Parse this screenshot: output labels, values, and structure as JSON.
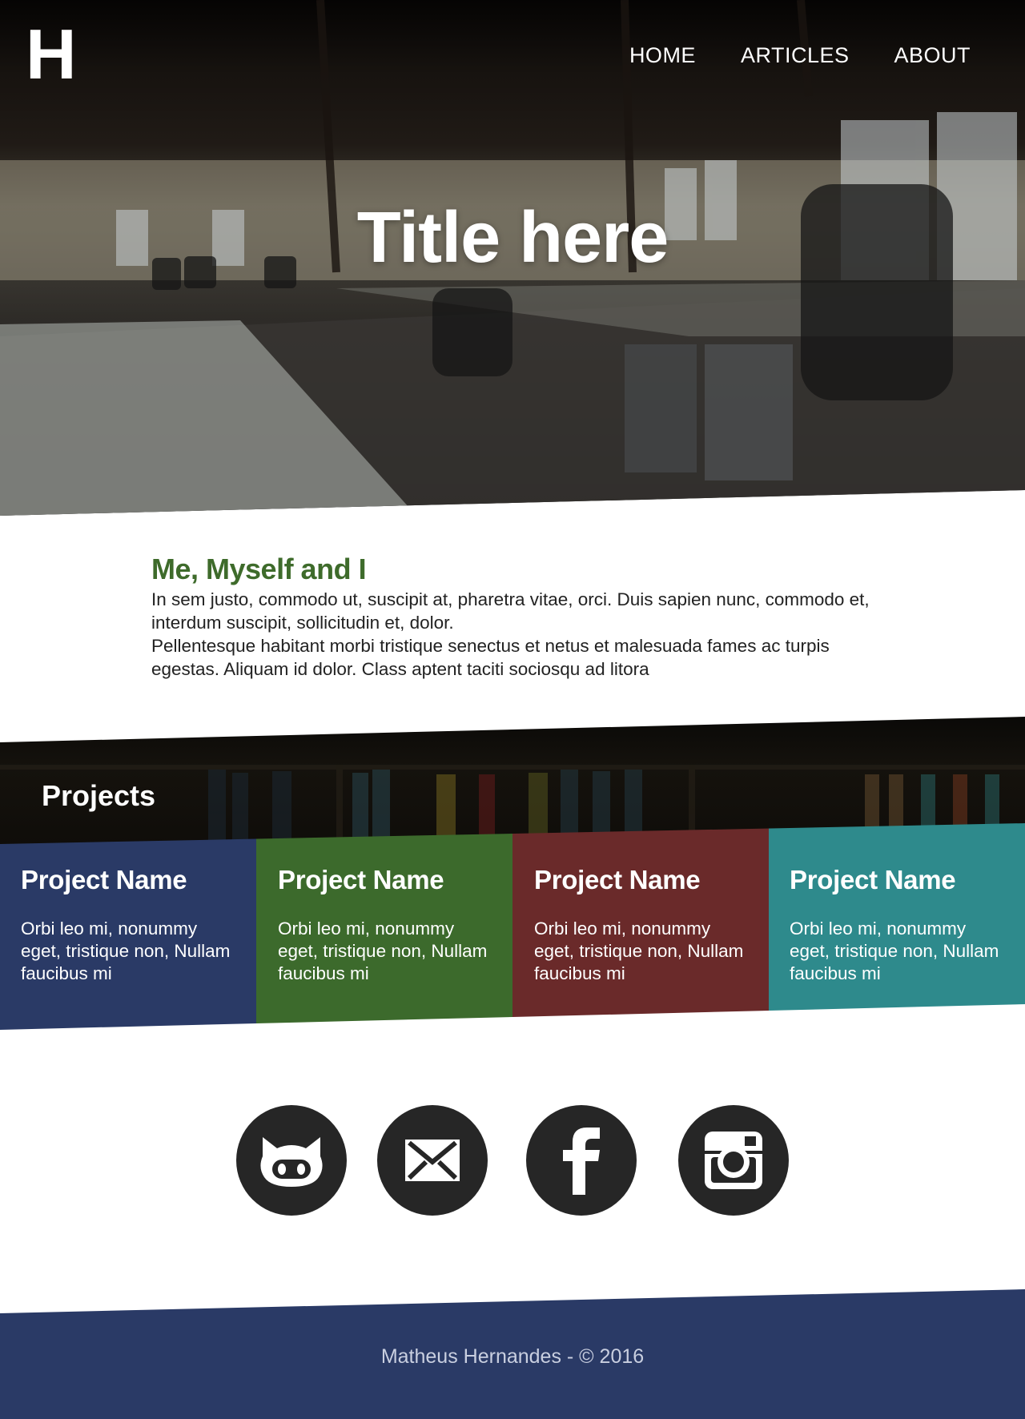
{
  "header": {
    "logo": "H",
    "nav": [
      "HOME",
      "ARTICLES",
      "ABOUT"
    ],
    "title": "Title here"
  },
  "about": {
    "heading": "Me, Myself and I",
    "paragraph1": "In sem justo, commodo ut, suscipit at, pharetra vitae, orci. Duis sapien nunc, commodo et, interdum suscipit, sollicitudin et, dolor.",
    "paragraph2": "Pellentesque habitant morbi tristique senectus et netus et malesuada fames ac turpis egestas. Aliquam id dolor. Class aptent taciti sociosqu ad litora"
  },
  "projects": {
    "title": "Projects",
    "items": [
      {
        "name": "Project Name",
        "description": "Orbi leo mi, nonummy eget, tristique non, Nullam faucibus mi",
        "color": "#2a3a66"
      },
      {
        "name": "Project Name",
        "description": "Orbi leo mi, nonummy eget, tristique non, Nullam faucibus mi",
        "color": "#3c6a2c"
      },
      {
        "name": "Project Name",
        "description": "Orbi leo mi, nonummy eget, tristique non, Nullam faucibus mi",
        "color": "#6a2a2a"
      },
      {
        "name": "Project Name",
        "description": "Orbi leo mi, nonummy eget, tristique non, Nullam faucibus mi",
        "color": "#2e8a8c"
      }
    ]
  },
  "social": {
    "icons": [
      "github-icon",
      "mail-icon",
      "facebook-icon",
      "instagram-icon"
    ],
    "color": "#262626"
  },
  "footer": {
    "text": "Matheus Hernandes - © 2016"
  }
}
